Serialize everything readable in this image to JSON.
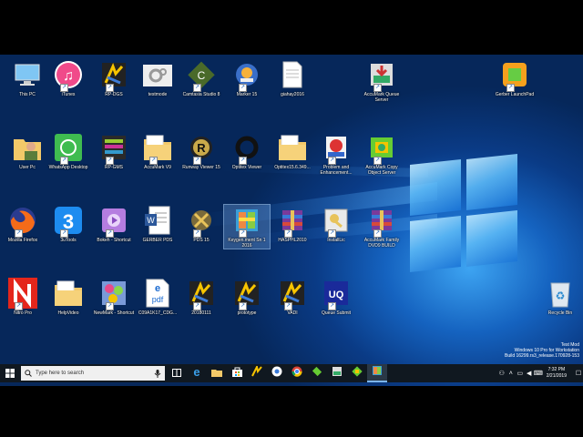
{
  "desktop": {
    "icons": [
      {
        "label": "This PC",
        "icon": "this-pc-icon",
        "shortcut": false
      },
      {
        "label": "iTunes",
        "icon": "itunes-icon",
        "shortcut": true
      },
      {
        "label": "RP-DGS",
        "icon": "rp-dgs-icon",
        "shortcut": true
      },
      {
        "label": "testmode",
        "icon": "testmode-icon",
        "shortcut": false
      },
      {
        "label": "Camtasia Studio 8",
        "icon": "camtasia-icon",
        "shortcut": true
      },
      {
        "label": "Marker 15",
        "icon": "marker-icon",
        "shortcut": true
      },
      {
        "label": "giahay2016",
        "icon": "text-file-icon",
        "shortcut": false
      },
      {
        "label": "AccuMark Queue Server",
        "icon": "accumark-queue-icon",
        "shortcut": true
      },
      {
        "label": "Gerber LaunchPad",
        "icon": "gerber-launchpad-icon",
        "shortcut": true
      },
      {
        "label": "User Pc",
        "icon": "user-folder-icon",
        "shortcut": false
      },
      {
        "label": "WhatsApp Desktop",
        "icon": "whatsapp-icon",
        "shortcut": true
      },
      {
        "label": "RP-GMS",
        "icon": "rp-gms-icon",
        "shortcut": true
      },
      {
        "label": "AccuMark V9",
        "icon": "folder-icon",
        "shortcut": true
      },
      {
        "label": "Runway Viewer 15",
        "icon": "runway-viewer-icon",
        "shortcut": true
      },
      {
        "label": "Optitex Viewer",
        "icon": "optitex-viewer-icon",
        "shortcut": true
      },
      {
        "label": "Optitex15.6.349...",
        "icon": "folder-icon",
        "shortcut": false
      },
      {
        "label": "Problem and Enhancement...",
        "icon": "problem-report-icon",
        "shortcut": true
      },
      {
        "label": "AccuMark Copy Object Server",
        "icon": "accumark-copy-icon",
        "shortcut": true
      },
      {
        "label": "Mozilla Firefox",
        "icon": "firefox-icon",
        "shortcut": true
      },
      {
        "label": "3uTools",
        "icon": "3utools-icon",
        "shortcut": true
      },
      {
        "label": "Bokeh - Shortcut",
        "icon": "bokeh-icon",
        "shortcut": true
      },
      {
        "label": "GERBER PDS",
        "icon": "word-doc-icon",
        "shortcut": false
      },
      {
        "label": "PDS 15",
        "icon": "pds-icon",
        "shortcut": true
      },
      {
        "label": "Keygen.ment Sn 1 2016",
        "icon": "keygen-icon",
        "shortcut": true
      },
      {
        "label": "HASPHL2010",
        "icon": "winrar-icon",
        "shortcut": true
      },
      {
        "label": "InstallLic",
        "icon": "installlic-icon",
        "shortcut": true
      },
      {
        "label": "AccuMark Family DVD9 BUILD",
        "icon": "winrar-icon",
        "shortcut": true
      },
      {
        "label": "Nitro Pro",
        "icon": "nitro-pro-icon",
        "shortcut": true
      },
      {
        "label": "HelpVideo",
        "icon": "folder-icon",
        "shortcut": false
      },
      {
        "label": "NewMark - Shortcut",
        "icon": "newmark-icon",
        "shortcut": true
      },
      {
        "label": "C09A1K17_CDG...",
        "icon": "pdf-icon",
        "shortcut": false
      },
      {
        "label": "20180111",
        "icon": "rp-dgs-icon",
        "shortcut": true
      },
      {
        "label": "prototype",
        "icon": "rp-dgs-icon",
        "shortcut": true
      },
      {
        "label": "VADI",
        "icon": "rp-dgs-icon",
        "shortcut": true
      },
      {
        "label": "Queue Submit",
        "icon": "queue-submit-icon",
        "shortcut": true
      },
      {
        "label": "Recycle Bin",
        "icon": "recycle-bin-icon",
        "shortcut": false
      }
    ],
    "selected_label": "Keygen.ment Sn 1 2016"
  },
  "watermark": {
    "line1": "Test Mod",
    "line2": "Windows 10 Pro for Workstation",
    "line3": "Build 16299.rs3_release.170928-153"
  },
  "taskbar": {
    "search_placeholder": "Type here to search",
    "apps": [
      "task-view-icon",
      "edge-icon",
      "file-explorer-icon",
      "store-icon",
      "app-icon-1",
      "chrome-icon-alt",
      "chrome-icon",
      "app-icon-2",
      "app-icon-3",
      "app-icon-4",
      "app-icon-5"
    ],
    "clock_time": "7:32 PM",
    "clock_date": "2/21/2019"
  },
  "colors": {
    "accent": "#1a74d6",
    "taskbar": "#101820"
  }
}
